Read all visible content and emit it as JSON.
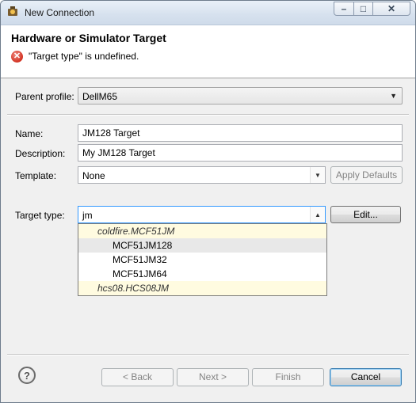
{
  "window": {
    "title": "New Connection"
  },
  "banner": {
    "title": "Hardware or Simulator Target",
    "message": "\"Target type\" is undefined."
  },
  "form": {
    "parent_profile": {
      "label": "Parent profile:",
      "value": "DellM65"
    },
    "name": {
      "label": "Name:",
      "value": "JM128 Target"
    },
    "description": {
      "label": "Description:",
      "value": "My JM128 Target"
    },
    "template": {
      "label": "Template:",
      "value": "None",
      "button": "Apply Defaults"
    },
    "target_type": {
      "label": "Target type:",
      "value": "jm",
      "button": "Edit..."
    }
  },
  "dropdown": {
    "items": [
      {
        "text": "coldfire.MCF51JM",
        "kind": "group"
      },
      {
        "text": "MCF51JM128",
        "kind": "item",
        "selected": true
      },
      {
        "text": "MCF51JM32",
        "kind": "item"
      },
      {
        "text": "MCF51JM64",
        "kind": "item"
      },
      {
        "text": "hcs08.HCS08JM",
        "kind": "group"
      }
    ]
  },
  "footer": {
    "help": "?",
    "back": "< Back",
    "next": "Next >",
    "finish": "Finish",
    "cancel": "Cancel"
  }
}
